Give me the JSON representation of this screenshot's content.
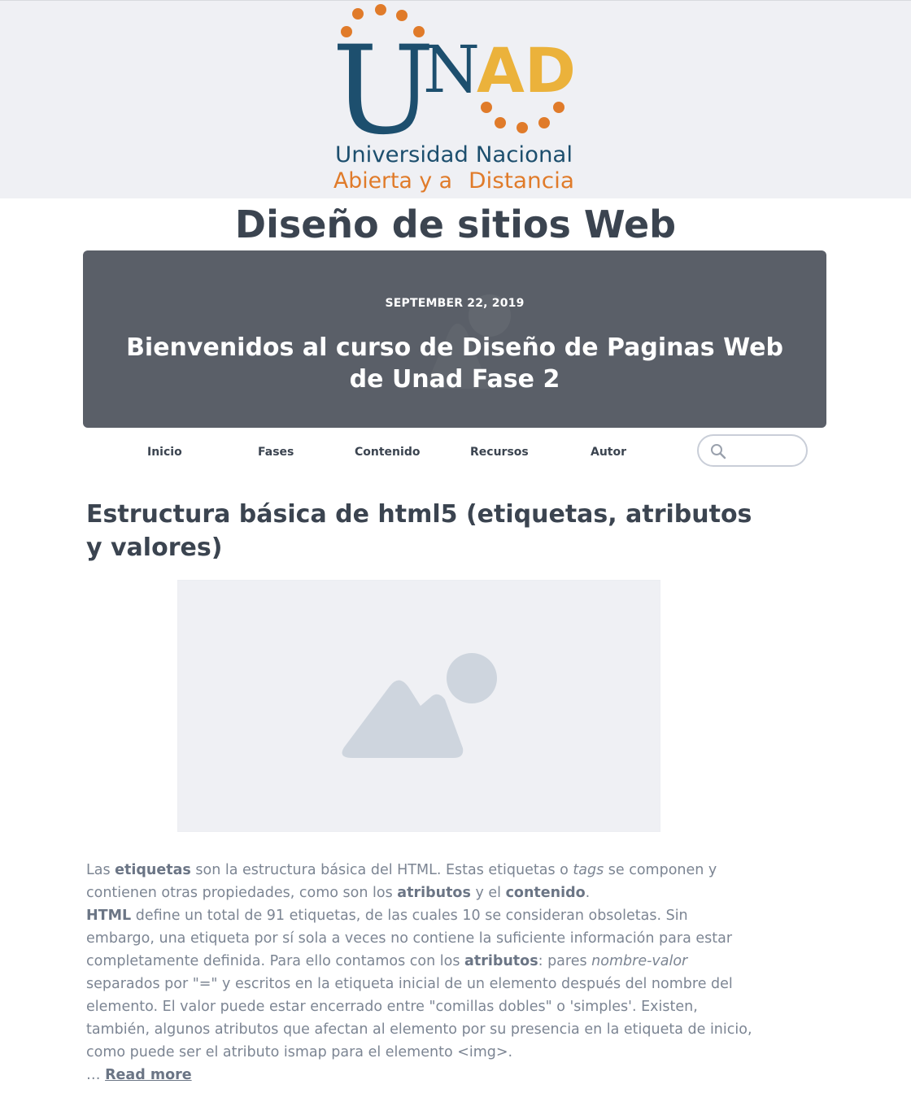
{
  "logo": {
    "wordmark_u": "U",
    "wordmark_n": "N",
    "wordmark_ad": "AD",
    "line1": "Universidad Nacional",
    "line2_a": "Abierta y a",
    "line2_b": "Distancia",
    "colors": {
      "navy": "#1d4f6e",
      "gold": "#ebb23b",
      "orange": "#e07b2a"
    }
  },
  "site": {
    "title": "Diseño de sitios Web"
  },
  "hero": {
    "date": "SEPTEMBER 22, 2019",
    "headline": "Bienvenidos al curso de Diseño de Paginas Web de Unad Fase 2",
    "background": "#5a5f68"
  },
  "nav": {
    "items": [
      {
        "label": "Inicio"
      },
      {
        "label": "Fases"
      },
      {
        "label": "Contenido"
      },
      {
        "label": "Recursos"
      },
      {
        "label": "Autor"
      }
    ],
    "search": {
      "placeholder": "",
      "icon": "search-icon"
    }
  },
  "post": {
    "title": "Estructura básica de html5 (etiquetas, atributos y valores)",
    "image_icon": "image-placeholder-icon",
    "p1": {
      "t1": "Las ",
      "b1": "etiquetas",
      "t2": " son la estructura básica del HTML. Estas etiquetas o ",
      "i1": "tags",
      "t3": " se componen y contienen otras propiedades, como son los ",
      "b2": "atributos",
      "t4": " y el ",
      "b3": "contenido",
      "t5": "."
    },
    "p2": {
      "b1": "HTML",
      "t1": " define un total de 91 etiquetas, de las cuales 10 se consideran obsoletas. Sin embargo, una etiqueta por sí sola a veces no contiene la suficiente información para estar completamente definida. Para ello contamos con los ",
      "b2": "atributos",
      "t2": ": pares ",
      "i1": "nombre-valor",
      "t3": " separados por \"=\" y escritos en la etiqueta inicial de un elemento después del nombre del elemento. El valor puede estar encerrado entre \"comillas dobles\" o 'simples'. Existen, también, algunos atributos que afectan al elemento por su presencia en la etiqueta de inicio, como puede ser el atributo ismap para el elemento <img>."
    },
    "ellipsis": "… ",
    "read_more": "Read more"
  }
}
